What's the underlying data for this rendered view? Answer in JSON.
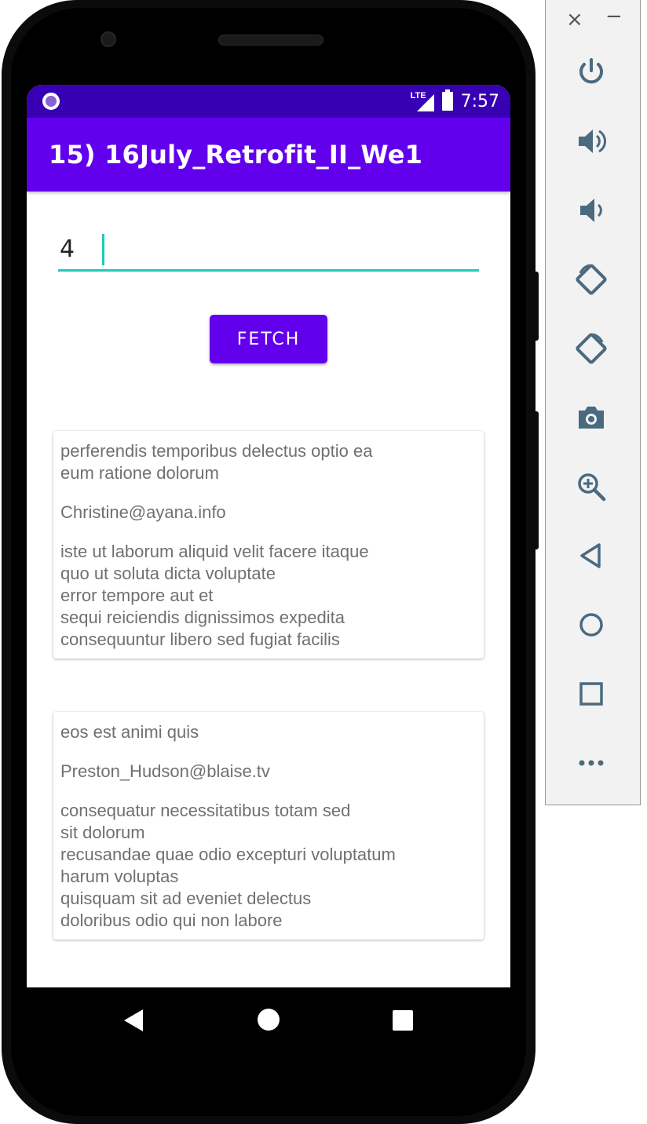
{
  "status_bar": {
    "time": "7:57",
    "network": "LTE"
  },
  "app_bar": {
    "title": "15) 16July_Retrofit_II_We1"
  },
  "input": {
    "value": "4"
  },
  "fetch_button": {
    "label": "FETCH"
  },
  "comments": [
    {
      "name": "perferendis temporibus delectus optio ea\neum ratione dolorum",
      "email": "Christine@ayana.info",
      "body": "iste ut laborum aliquid velit facere itaque\nquo ut soluta dicta voluptate\nerror tempore aut et\nsequi reiciendis dignissimos expedita\nconsequuntur libero sed fugiat facilis"
    },
    {
      "name": "eos est animi quis",
      "email": "Preston_Hudson@blaise.tv",
      "body": "consequatur necessitatibus totam sed\nsit dolorum\nrecusandae quae odio excepturi voluptatum\nharum voluptas\nquisquam sit ad eveniet delectus\ndoloribus odio qui non labore"
    }
  ],
  "emulator_panel": {
    "close_glyph": "×",
    "minimize_glyph": "−",
    "tools": [
      "power-icon",
      "volume-up-icon",
      "volume-down-icon",
      "rotate-left-icon",
      "rotate-right-icon",
      "camera-icon",
      "zoom-icon",
      "back-icon",
      "home-icon",
      "overview-icon",
      "more-icon"
    ]
  },
  "colors": {
    "primary": "#6200ee",
    "primary_dark": "#3700b3",
    "accent": "#1fc9b8",
    "card_text": "#707070",
    "panel_icon": "#4a6a80"
  }
}
